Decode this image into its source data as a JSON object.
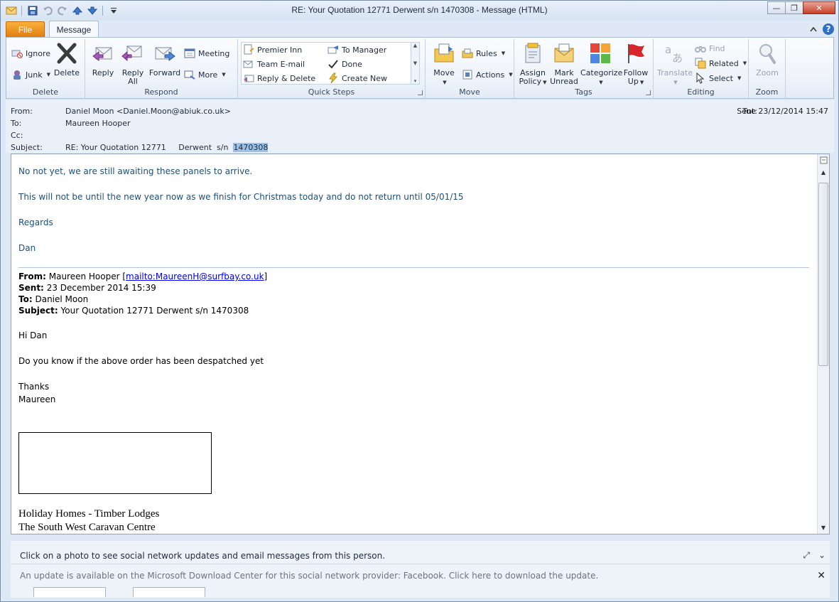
{
  "window": {
    "title": "RE: Your Quotation 12771     Derwent  s/n  1470308  -  Message (HTML)",
    "minimize": "—",
    "maximize": "❐",
    "close": "✕"
  },
  "tabs": {
    "file": "File",
    "message": "Message"
  },
  "ribbon": {
    "delete_group": {
      "label": "Delete",
      "ignore": "Ignore",
      "junk": "Junk",
      "delete": "Delete"
    },
    "respond_group": {
      "label": "Respond",
      "reply": "Reply",
      "reply_all_1": "Reply",
      "reply_all_2": "All",
      "forward": "Forward",
      "meeting": "Meeting",
      "more": "More"
    },
    "quick_steps": {
      "label": "Quick Steps",
      "items": [
        "Premier Inn",
        "To Manager",
        "Team E-mail",
        "Done",
        "Reply & Delete",
        "Create New"
      ]
    },
    "move_group": {
      "label": "Move",
      "move": "Move",
      "rules": "Rules",
      "actions": "Actions"
    },
    "tags_group": {
      "label": "Tags",
      "assign_1": "Assign",
      "assign_2": "Policy",
      "mark_1": "Mark",
      "mark_2": "Unread",
      "categorize": "Categorize",
      "follow_1": "Follow",
      "follow_2": "Up"
    },
    "editing_group": {
      "label": "Editing",
      "translate": "Translate",
      "find": "Find",
      "related": "Related",
      "select": "Select"
    },
    "zoom_group": {
      "label": "Zoom",
      "zoom": "Zoom"
    }
  },
  "header": {
    "from_label": "From:",
    "from_value": "Daniel Moon <Daniel.Moon@abiuk.co.uk>",
    "to_label": "To:",
    "to_value": "Maureen Hooper",
    "cc_label": "Cc:",
    "cc_value": "",
    "subject_label": "Subject:",
    "subject_prefix": "RE: Your Quotation 12771     Derwent  s/n  ",
    "subject_selected": "1470308",
    "sent_label": "Sent:",
    "sent_value": "Tue 23/12/2014 15:47"
  },
  "message": {
    "reply_lines": [
      "No not yet, we are still awaiting these panels to arrive.",
      "This will not be until the new year now as we finish for Christmas today and do not return until 05/01/15",
      "Regards",
      "Dan"
    ],
    "quoted": {
      "from_label": "From:",
      "from_name": "Maureen Hooper [",
      "from_link": "mailto:MaureenH@surfbay.co.uk",
      "from_close": "]",
      "sent_label": "Sent:",
      "sent_value": "23 December 2014 15:39",
      "to_label": "To:",
      "to_value": "Daniel Moon",
      "subject_label": "Subject:",
      "subject_value": "Your Quotation 12771 Derwent s/n 1470308",
      "greeting": "Hi Dan",
      "body": "Do you know if the above order has been despatched yet",
      "signoff_1": "Thanks",
      "signoff_2": "Maureen",
      "company_1": "Holiday Homes - Timber Lodges",
      "company_2": "The South West Caravan Centre"
    }
  },
  "people_pane": {
    "info": "Click on a photo to see social network updates and email messages from this person.",
    "update": "An update is available on the Microsoft Download Center for this social network provider: Facebook. Click here to download the update."
  }
}
